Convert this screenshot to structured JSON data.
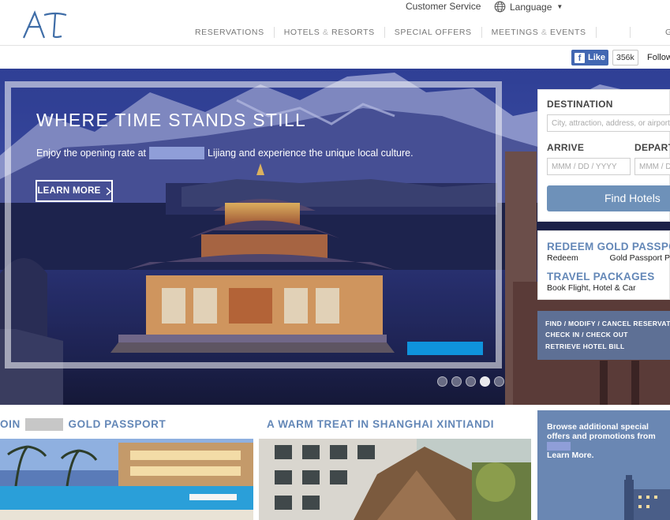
{
  "header": {
    "logo_text": "AT",
    "customer_service": "Customer Service",
    "language": "Language",
    "nav": [
      {
        "label": "RESERVATIONS"
      },
      {
        "label_a": "HOTELS",
        "amp": "&",
        "label_b": "RESORTS"
      },
      {
        "label": "SPECIAL OFFERS"
      },
      {
        "label_a": "MEETINGS",
        "amp": "&",
        "label_b": "EVENTS"
      }
    ],
    "nav_last": "G"
  },
  "social": {
    "like_label": "Like",
    "like_count": "356k",
    "follow_label": "Follow"
  },
  "hero": {
    "title": "WHERE TIME STANDS STILL",
    "sub_before": "Enjoy the opening rate at",
    "sub_after": "Lijiang and experience the unique local culture.",
    "learn_more": "LEARN MORE",
    "slides": 5,
    "active_slide": 4
  },
  "booking": {
    "destination_label": "DESTINATION",
    "destination_placeholder": "City, attraction, address, or airport",
    "arrive_label": "ARRIVE",
    "depart_label": "DEPART",
    "date_placeholder": "MMM / DD / YYYY",
    "find_button": "Find Hotels"
  },
  "links": {
    "redeem_title": "REDEEM GOLD PASSPORT",
    "redeem_sub_a": "Redeem",
    "redeem_sub_b": "Gold Passport Points",
    "travel_title": "TRAVEL PACKAGES",
    "travel_sub": "Book Flight, Hotel & Car"
  },
  "manage": {
    "find_modify": "FIND / MODIFY / CANCEL RESERVATION",
    "check_in": "CHECK IN / CHECK OUT",
    "retrieve": "RETRIEVE HOTEL BILL"
  },
  "cards": {
    "card1_title_a": "OIN",
    "card1_title_b": "GOLD PASSPORT",
    "card2_title": "A WARM TREAT IN SHANGHAI XINTIANDI",
    "card3_text_a": "Browse additional special offers and promotions from",
    "card3_text_b": "Learn More."
  },
  "colors": {
    "accent_blue": "#6387b7",
    "button_blue": "#6e91b9",
    "hero_bar": "#0f93dc",
    "facebook": "#4267b2"
  }
}
